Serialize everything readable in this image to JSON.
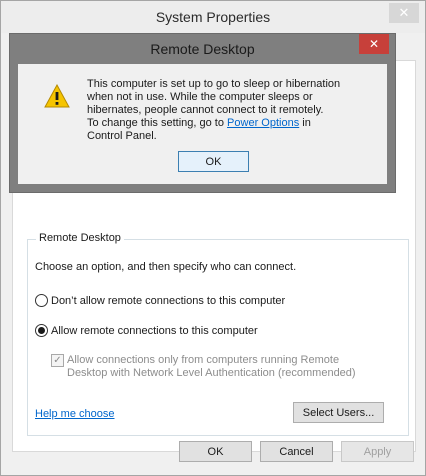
{
  "main_window": {
    "title": "System Properties",
    "close_glyph": "✕"
  },
  "remote_group": {
    "legend": "Remote Desktop",
    "instructions": "Choose an option, and then specify who can connect.",
    "option_dont_allow": "Don’t allow remote connections to this computer",
    "option_allow": "Allow remote connections to this computer",
    "nla_line1": "Allow connections only from computers running Remote",
    "nla_line2": "Desktop with Network Level Authentication (recommended)",
    "help_link": "Help me choose",
    "select_users_button": "Select Users..."
  },
  "footer_buttons": {
    "ok": "OK",
    "cancel": "Cancel",
    "apply": "Apply"
  },
  "modal": {
    "title": "Remote Desktop",
    "close_glyph": "✕",
    "message_lines": [
      "This computer is set up to go to sleep or hibernation",
      "when not in use. While the computer sleeps or",
      "hibernates, people cannot connect to it remotely.",
      "To change this setting, go to",
      "Control Panel."
    ],
    "power_options_link": "Power Options",
    "message_after_link": " in",
    "ok_button": "OK"
  },
  "colors": {
    "modal_close": "#c7403a",
    "link": "#0066cc",
    "warning_yellow": "#f5c400"
  },
  "icons": {
    "warning": "warning-icon"
  }
}
